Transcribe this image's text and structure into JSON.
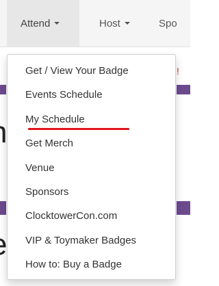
{
  "navbar": {
    "items": [
      {
        "label": "Attend",
        "has_caret": true
      },
      {
        "label": "Host",
        "has_caret": true
      },
      {
        "label": "Spo",
        "has_caret": false
      }
    ]
  },
  "dropdown": {
    "items": [
      {
        "label": "Get / View Your Badge"
      },
      {
        "label": "Events Schedule"
      },
      {
        "label": "My Schedule",
        "annotated": true
      },
      {
        "label": "Get Merch"
      },
      {
        "label": "Venue"
      },
      {
        "label": "Sponsors"
      },
      {
        "label": "ClocktowerCon.com"
      },
      {
        "label": "VIP & Toymaker Badges"
      },
      {
        "label": "How to: Buy a Badge"
      }
    ]
  },
  "background": {
    "letter_1": "h",
    "letter_2": "e",
    "fragment": "!"
  },
  "colors": {
    "nav_bg": "#f5f5f5",
    "active_nav_bg": "#e7e7e7",
    "accent_purple": "#6c4a8e",
    "annotation_red": "#e0151b"
  }
}
